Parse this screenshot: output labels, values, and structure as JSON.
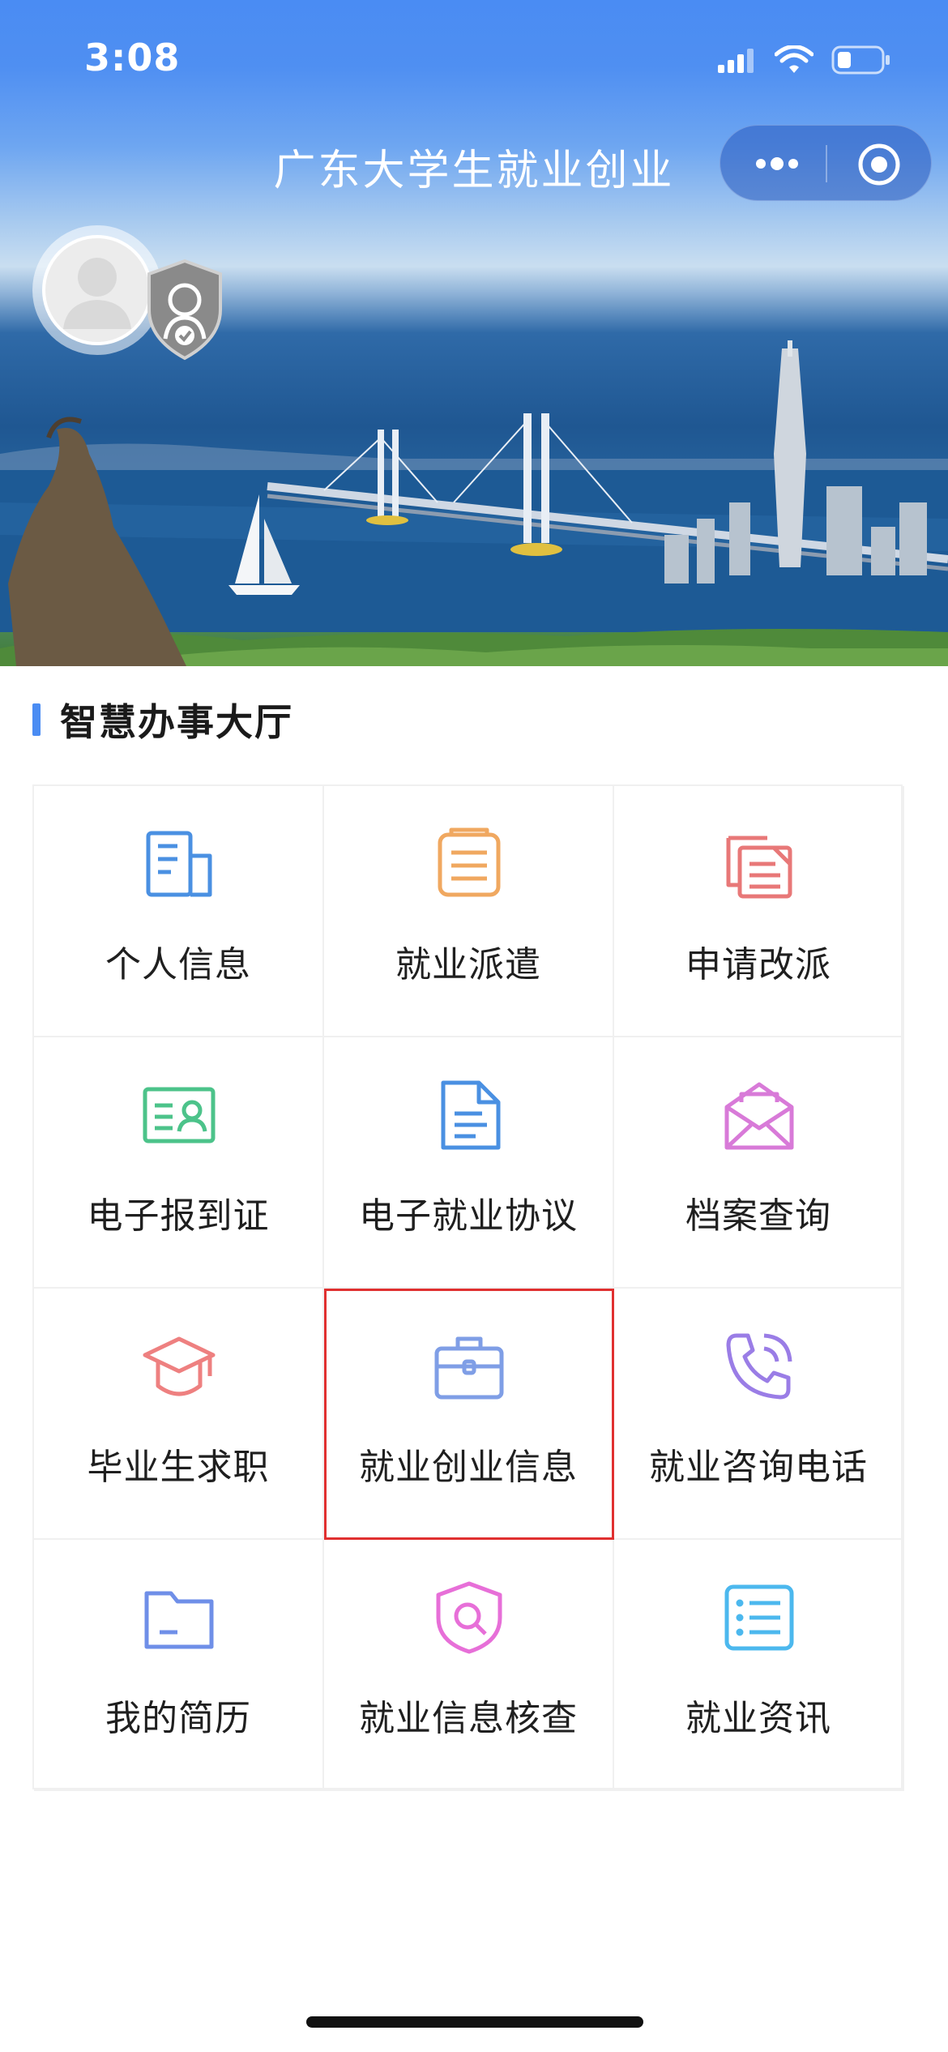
{
  "status_bar": {
    "time": "3:08"
  },
  "header": {
    "title": "广东大学生就业创业"
  },
  "section": {
    "title": "智慧办事大厅"
  },
  "colors": {
    "brand_blue": "#4a8cf3",
    "highlight_red": "#e03030"
  },
  "grid": {
    "items": [
      {
        "label": "个人信息",
        "icon": "profile-document-icon",
        "color": "#4a90e2"
      },
      {
        "label": "就业派遣",
        "icon": "clipboard-list-icon",
        "color": "#f0a860"
      },
      {
        "label": "申请改派",
        "icon": "documents-copy-icon",
        "color": "#e87878"
      },
      {
        "label": "电子报到证",
        "icon": "id-card-icon",
        "color": "#4cc38a"
      },
      {
        "label": "电子就业协议",
        "icon": "agreement-document-icon",
        "color": "#4a90e2"
      },
      {
        "label": "档案查询",
        "icon": "envelope-icon",
        "color": "#d87ad8"
      },
      {
        "label": "毕业生求职",
        "icon": "graduation-cap-icon",
        "color": "#ee8080"
      },
      {
        "label": "就业创业信息",
        "icon": "briefcase-icon",
        "color": "#7f9ee6"
      },
      {
        "label": "就业咨询电话",
        "icon": "phone-call-icon",
        "color": "#9a7de6"
      },
      {
        "label": "我的简历",
        "icon": "folder-icon",
        "color": "#6f8fe8"
      },
      {
        "label": "就业信息核查",
        "icon": "shield-search-icon",
        "color": "#e76fd8"
      },
      {
        "label": "就业资讯",
        "icon": "news-list-icon",
        "color": "#4cb8ee"
      }
    ]
  }
}
